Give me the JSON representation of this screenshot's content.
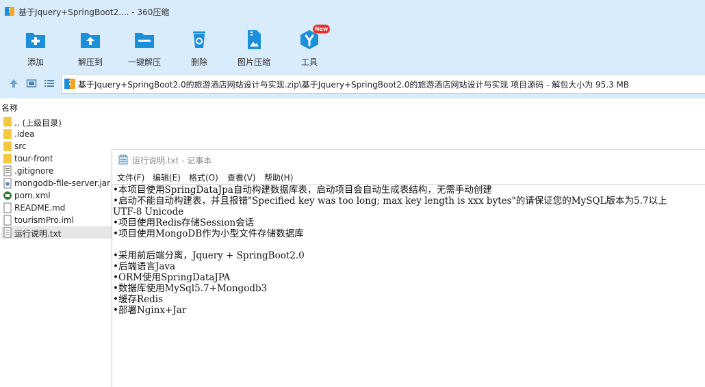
{
  "window": {
    "title": "基于Jquery+SpringBoot2.... - 360压缩"
  },
  "toolbar": {
    "add_label": "添加",
    "extract_to_label": "解压到",
    "one_click_extract_label": "一键解压",
    "delete_label": "删除",
    "image_compress_label": "图片压缩",
    "tools_label": "工具",
    "tools_badge": "New"
  },
  "address": {
    "path": "基于Jquery+SpringBoot2.0的旅游酒店网站设计与实现.zip\\基于Jquery+SpringBoot2.0的旅游酒店网站设计与实现 项目源码 - 解包大小为 95.3 MB"
  },
  "file_list": {
    "column_name": "名称",
    "items": [
      {
        "name": ".. (上级目录)",
        "icon": "folder-icon"
      },
      {
        "name": ".idea",
        "icon": "folder-icon"
      },
      {
        "name": "src",
        "icon": "folder-icon"
      },
      {
        "name": "tour-front",
        "icon": "folder-icon"
      },
      {
        "name": ".gitignore",
        "icon": "text-file-icon"
      },
      {
        "name": "mongodb-file-server.jar",
        "icon": "jar-file-icon"
      },
      {
        "name": "pom.xml",
        "icon": "xml-file-icon"
      },
      {
        "name": "README.md",
        "icon": "blank-file-icon"
      },
      {
        "name": "tourismPro.iml",
        "icon": "blank-file-icon"
      },
      {
        "name": "运行说明.txt",
        "icon": "text-file-icon"
      }
    ]
  },
  "notepad": {
    "title": "运行说明.txt - 记事本",
    "menu": [
      "文件(F)",
      "编辑(E)",
      "格式(O)",
      "查看(V)",
      "帮助(H)"
    ],
    "lines": [
      "•本项目使用SpringDataJpa自动构建数据库表，启动项目会自动生成表结构，无需手动创建",
      "•启动不能自动构建表，并且报错\"Specified key was too long; max key length is xxx bytes\"的请保证您的MySQL版本为5.7以上",
      "UTF-8 Unicode",
      "•项目使用Redis存储Session会话",
      "•项目使用MongoDB作为小型文件存储数据库",
      "",
      "•采用前后端分离，Jquery + SpringBoot2.0",
      "•后端语言Java",
      "•ORM使用SpringDataJPA",
      "•数据库使用MySql5.7+Mongodb3",
      "•缓存Redis",
      "•部署Nginx+Jar"
    ]
  },
  "colors": {
    "chrome_bg": "#d9ecfb",
    "icon_blue": "#1b8fd9",
    "folder_yellow": "#f5c842",
    "badge_red": "#e8322d"
  }
}
